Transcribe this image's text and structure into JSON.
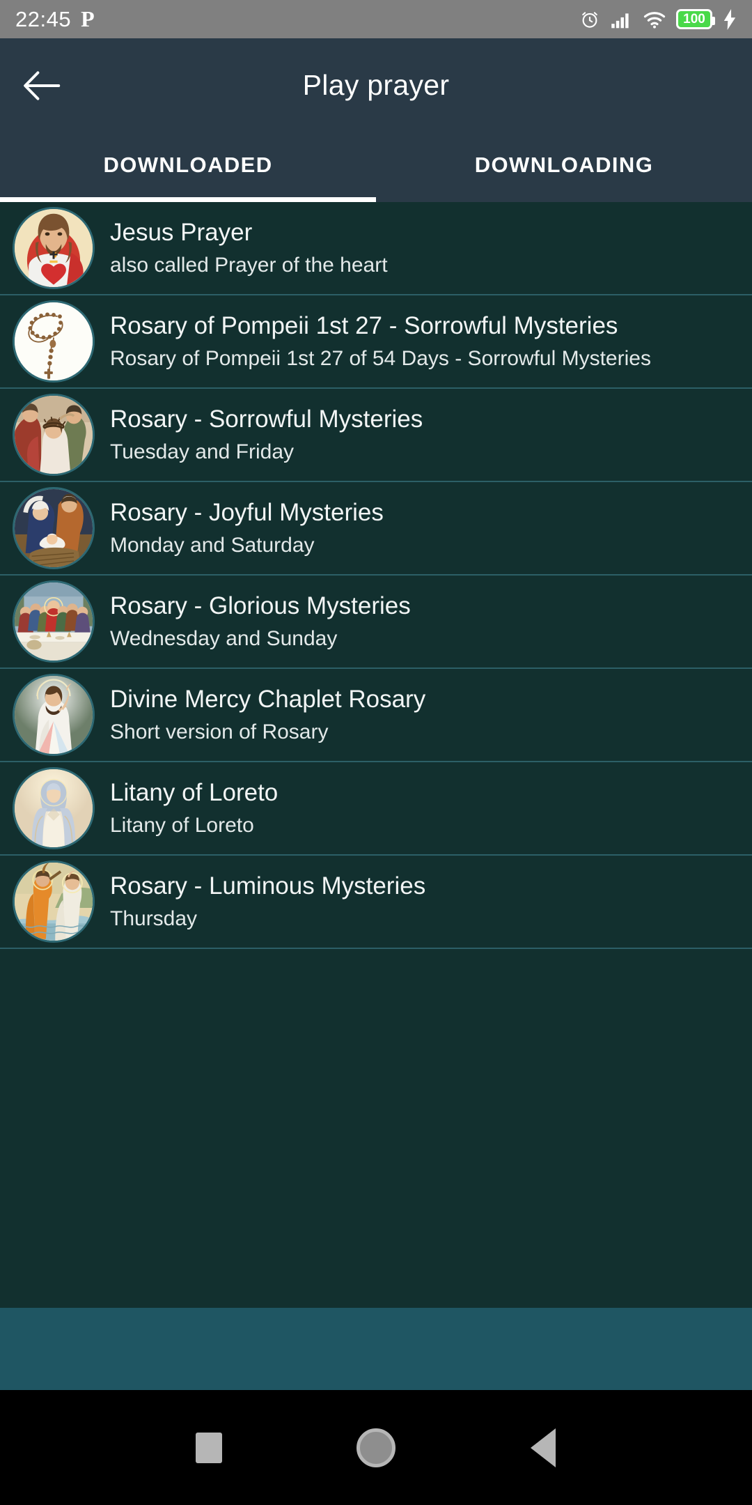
{
  "statusbar": {
    "time": "22:45",
    "app_badge": "P",
    "alarm_icon": "alarm-clock-icon",
    "signal_icon": "cellular-signal-icon",
    "wifi_icon": "wifi-icon",
    "battery_level": "100",
    "charging_icon": "charging-bolt-icon",
    "battery_color": "#49d949"
  },
  "appbar": {
    "back_icon": "back-arrow-icon",
    "title": "Play prayer",
    "bg_color": "#2a3a47"
  },
  "tabs": {
    "items": [
      {
        "label": "DOWNLOADED",
        "active": true
      },
      {
        "label": "DOWNLOADING",
        "active": false
      }
    ],
    "indicator_color": "#ffffff"
  },
  "list": {
    "bg_color": "#12302f",
    "divider_color": "#2c5f67",
    "items": [
      {
        "title": "Jesus Prayer",
        "subtitle": "also called Prayer of the heart",
        "thumbnail": "sacred-heart-of-jesus-image"
      },
      {
        "title": "Rosary of Pompeii 1st 27 - Sorrowful Mysteries",
        "subtitle": "Rosary of Pompeii 1st 27 of 54 Days - Sorrowful Mysteries",
        "thumbnail": "rosary-beads-image"
      },
      {
        "title": "Rosary - Sorrowful Mysteries",
        "subtitle": "Tuesday and Friday",
        "thumbnail": "crowning-with-thorns-image"
      },
      {
        "title": "Rosary - Joyful Mysteries",
        "subtitle": "Monday and Saturday",
        "thumbnail": "nativity-image"
      },
      {
        "title": "Rosary - Glorious Mysteries",
        "subtitle": "Wednesday and Sunday",
        "thumbnail": "last-supper-image"
      },
      {
        "title": "Divine Mercy Chaplet Rosary",
        "subtitle": "Short version of Rosary",
        "thumbnail": "divine-mercy-image"
      },
      {
        "title": "Litany of Loreto",
        "subtitle": "Litany of Loreto",
        "thumbnail": "virgin-mary-image"
      },
      {
        "title": "Rosary - Luminous Mysteries",
        "subtitle": "Thursday",
        "thumbnail": "baptism-of-jesus-image"
      }
    ]
  },
  "footer": {
    "strip_color": "#1f5663"
  },
  "navbar": {
    "recents_icon": "square-recents-icon",
    "home_icon": "circle-home-icon",
    "back_icon": "triangle-back-icon",
    "bg_color": "#000000"
  }
}
